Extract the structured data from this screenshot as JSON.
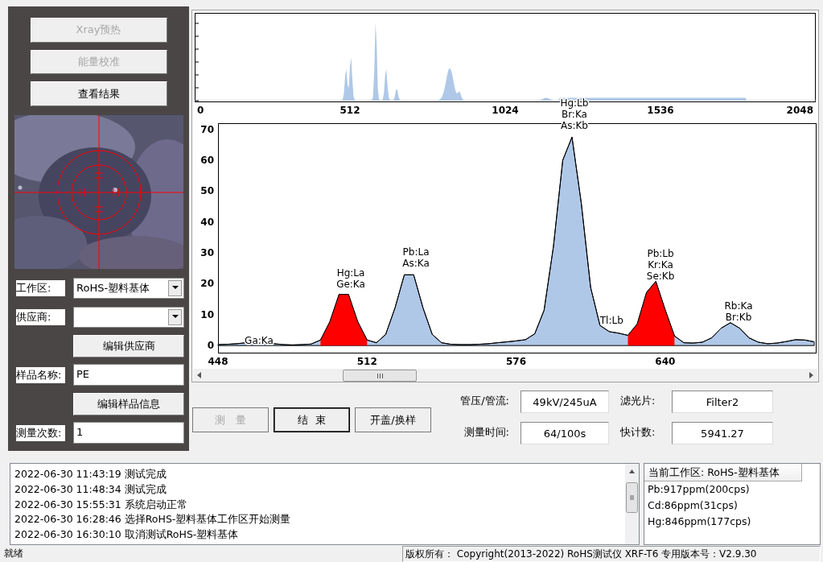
{
  "left_panel": {
    "buttons": [
      {
        "label": "Xray预热",
        "disabled": true
      },
      {
        "label": "能量校准",
        "disabled": true
      },
      {
        "label": "查看结果",
        "disabled": false
      }
    ],
    "form": [
      {
        "kind": "combo",
        "label": "工作区:",
        "value": "RoHS-塑料基体"
      },
      {
        "kind": "combo",
        "label": "供应商:"
      },
      {
        "kind": "button",
        "label": "编辑供应商"
      },
      {
        "kind": "input",
        "label": "样品名称:",
        "value": "PE"
      },
      {
        "kind": "button",
        "label": "编辑样品信息"
      },
      {
        "kind": "input",
        "label": "测量次数:",
        "value": "1"
      }
    ]
  },
  "overview": {
    "xtick_labels": [
      "0",
      "512",
      "1024",
      "1536",
      "2048"
    ]
  },
  "spectrum": {
    "chart_data": {
      "type": "area",
      "xlim": [
        448,
        705
      ],
      "ylim": [
        -2.3,
        72
      ],
      "xticks": [
        448,
        512,
        576,
        640
      ],
      "yticks": [
        0,
        10,
        20,
        30,
        40,
        50,
        60,
        70
      ],
      "x": [
        448,
        452,
        456,
        460,
        464,
        468,
        472,
        476,
        480,
        484,
        488,
        492,
        496,
        500,
        504,
        508,
        512,
        516,
        520,
        524,
        528,
        532,
        536,
        540,
        544,
        548,
        552,
        556,
        560,
        564,
        568,
        572,
        576,
        580,
        584,
        588,
        592,
        596,
        600,
        604,
        608,
        612,
        616,
        620,
        624,
        628,
        632,
        636,
        640,
        644,
        648,
        652,
        656,
        660,
        664,
        668,
        672,
        676,
        680,
        684,
        688,
        692,
        696,
        700,
        704
      ],
      "series": [
        {
          "color": "#b0c8e8",
          "values": [
            0.3,
            0.4,
            0.6,
            0.9,
            1.1,
            1.0,
            0.6,
            0.3,
            0.2,
            0.3,
            0.5,
            1.8,
            7.7,
            16.6,
            16.6,
            7.7,
            1.8,
            0.9,
            3.6,
            12.2,
            22.9,
            22.9,
            12.2,
            3.6,
            0.9,
            0.4,
            0.3,
            0.3,
            0.4,
            0.6,
            0.9,
            1.2,
            1.5,
            1.9,
            3.8,
            11.4,
            32,
            60,
            67.5,
            46,
            18.8,
            6.5,
            4.5,
            4,
            3.3,
            7,
            17.2,
            20.8,
            11.6,
            3.1,
            0.9,
            0.8,
            1.1,
            2.5,
            5.6,
            7.4,
            5.6,
            2.5,
            1.1,
            0.6,
            0.8,
            1.3,
            1.9,
            1.8,
            1.2
          ]
        },
        {
          "color": "#ff0000",
          "values": [
            null,
            null,
            null,
            null,
            null,
            null,
            null,
            null,
            null,
            null,
            null,
            1.8,
            7.7,
            16.6,
            16.6,
            7.7,
            1.8,
            null,
            null,
            null,
            null,
            null,
            null,
            null,
            null,
            null,
            null,
            null,
            null,
            null,
            null,
            null,
            null,
            null,
            null,
            null,
            null,
            null,
            null,
            null,
            null,
            null,
            null,
            null,
            3.3,
            7,
            17.2,
            20.8,
            11.6,
            3.1,
            null,
            null,
            null,
            null,
            null,
            null,
            null,
            null,
            null,
            null,
            null,
            null,
            null,
            null,
            null
          ]
        }
      ]
    },
    "peak_labels": [
      {
        "lines": [
          "Ga:Ka"
        ]
      },
      {
        "lines": [
          "Hg:La",
          "Ge:Ka"
        ]
      },
      {
        "lines": [
          "Pb:La",
          "As:Ka"
        ]
      },
      {
        "lines": [
          "Hg:Lb",
          "Br:Ka",
          "As:Kb"
        ]
      },
      {
        "lines": [
          "Tl:Lb"
        ]
      },
      {
        "lines": [
          "Pb:Lb",
          "Kr:Ka",
          "Se:Kb"
        ]
      },
      {
        "lines": [
          "Rb:Ka",
          "Br:Kb"
        ]
      }
    ]
  },
  "controls": {
    "buttons": [
      {
        "label": "测   量",
        "disabled": true,
        "focused": false
      },
      {
        "label": "结  束",
        "disabled": false,
        "focused": true
      },
      {
        "label": "开盖/换样",
        "disabled": false,
        "focused": false
      }
    ],
    "readouts": [
      {
        "label": "管压/管流:",
        "value": "49kV/245uA"
      },
      {
        "label": "滤光片:",
        "value": "Filter2"
      },
      {
        "label": "测量时间:",
        "value": "64/100s"
      },
      {
        "label": "快计数:",
        "value": "5941.27"
      }
    ]
  },
  "log": {
    "entries": [
      "2022-06-30 11:43:19 测试完成",
      "2022-06-30 11:48:34 测试完成",
      "2022-06-30 15:55:31 系统启动正常",
      "2022-06-30 16:28:46 选择RoHS-塑料基体工作区开始测量",
      "2022-06-30 16:30:10 取消测试RoHS-塑料基体"
    ]
  },
  "results": {
    "header": "当前工作区: RoHS-塑料基体",
    "items": [
      "Pb:917ppm(200cps)",
      "Cd:86ppm(31cps)",
      "Hg:846ppm(177cps)"
    ]
  },
  "status_bar": {
    "state": "就绪",
    "copyright": "版权所有： Copyright(2013-2022) RoHS测试仪 XRF-T6 专用版本号：V2.9.30"
  }
}
